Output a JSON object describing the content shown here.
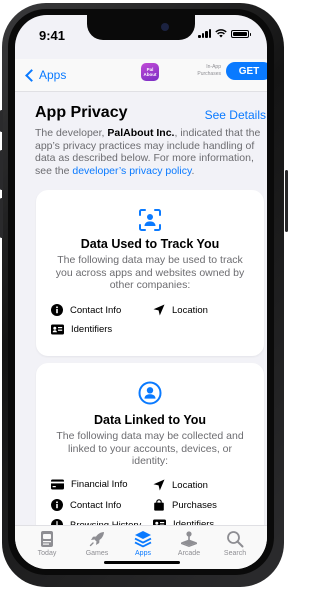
{
  "status": {
    "time": "9:41"
  },
  "nav": {
    "back_label": "Apps",
    "app_icon_text": "Pal About",
    "iap_label": "In-App Purchases",
    "get_label": "GET"
  },
  "page": {
    "title": "App Privacy",
    "see_details": "See Details",
    "intro_prefix": "The developer, ",
    "developer": "PalAbout Inc.",
    "intro_middle": ", indicated that the app’s privacy practices may include handling of data as described below. For more information, see the ",
    "policy_link": "developer’s privacy policy",
    "intro_suffix": "."
  },
  "track_card": {
    "icon": "tracking-person-icon",
    "title": "Data Used to Track You",
    "description": "The following data may be used to track you across apps and websites owned by other companies:",
    "items": [
      {
        "label": "Contact Info",
        "icon": "info-icon"
      },
      {
        "label": "Location",
        "icon": "location-arrow-icon"
      },
      {
        "label": "Identifiers",
        "icon": "id-card-icon"
      }
    ]
  },
  "linked_card": {
    "icon": "person-circle-icon",
    "title": "Data Linked to You",
    "description": "The following data may be collected and linked to your accounts, devices, or identity:",
    "items": [
      {
        "label": "Financial Info",
        "icon": "credit-card-icon"
      },
      {
        "label": "Location",
        "icon": "location-arrow-icon"
      },
      {
        "label": "Contact Info",
        "icon": "info-icon"
      },
      {
        "label": "Purchases",
        "icon": "shopping-bag-icon"
      },
      {
        "label": "Browsing History",
        "icon": "clock-icon"
      },
      {
        "label": "Identifiers",
        "icon": "id-card-icon"
      }
    ]
  },
  "tabs": [
    {
      "label": "Today",
      "icon": "today-icon"
    },
    {
      "label": "Games",
      "icon": "rocket-icon"
    },
    {
      "label": "Apps",
      "icon": "layers-icon",
      "active": true
    },
    {
      "label": "Arcade",
      "icon": "joystick-icon"
    },
    {
      "label": "Search",
      "icon": "search-icon"
    }
  ],
  "colors": {
    "accent": "#0a7aff",
    "background": "#f2f2f7",
    "secondary_text": "#6c6c70"
  }
}
